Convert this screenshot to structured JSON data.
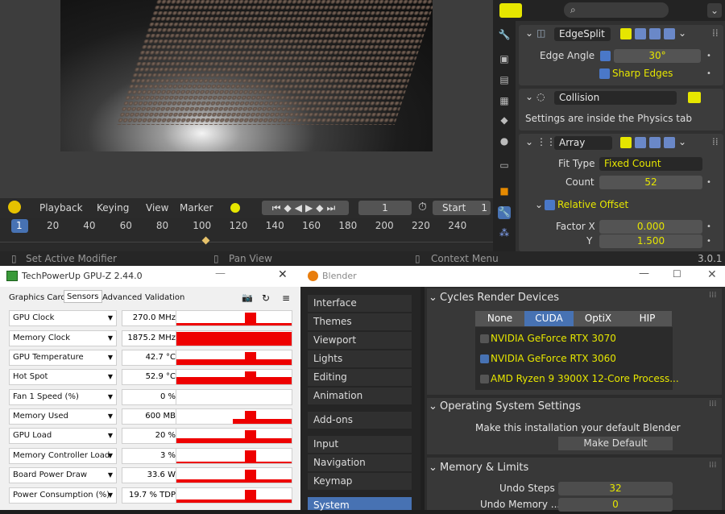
{
  "viewport": {
    "description_hidden": ""
  },
  "timeline": {
    "playback": "Playback",
    "keying": "Keying",
    "view": "View",
    "marker": "Marker",
    "current_frame": "1",
    "start_label": "Start",
    "start_value": "1",
    "ruler": [
      "1",
      "20",
      "40",
      "60",
      "80",
      "100",
      "120",
      "140",
      "160",
      "180",
      "200",
      "220",
      "240"
    ]
  },
  "status": {
    "left": "Set Active Modifier",
    "middle": "Pan View",
    "right": "Context Menu",
    "version": "3.0.1"
  },
  "properties": {
    "edgesplit": {
      "name": "EdgeSplit",
      "edge_angle_label": "Edge Angle",
      "edge_angle_value": "30°",
      "sharp_edges_label": "Sharp Edges"
    },
    "collision": {
      "name": "Collision",
      "info": "Settings are inside the Physics tab"
    },
    "array": {
      "name": "Array",
      "fit_type_label": "Fit Type",
      "fit_type_value": "Fixed Count",
      "count_label": "Count",
      "count_value": "52",
      "relative_offset_label": "Relative Offset",
      "factor_x_label": "Factor X",
      "factor_x_value": "0.000",
      "y_label": "Y",
      "y_value": "1.500"
    }
  },
  "gpuz": {
    "title": "TechPowerUp GPU-Z 2.44.0",
    "tabs": [
      "Graphics Card",
      "Sensors",
      "Advanced",
      "Validation"
    ],
    "sensors": [
      {
        "name": "GPU Clock",
        "value": "270.0 MHz",
        "level": 0.1
      },
      {
        "name": "Memory Clock",
        "value": "1875.2 MHz",
        "level": 0.6
      },
      {
        "name": "GPU Temperature",
        "value": "42.7 °C",
        "level": 0.25
      },
      {
        "name": "Hot Spot",
        "value": "52.9 °C",
        "level": 0.3
      },
      {
        "name": "Fan 1 Speed (%)",
        "value": "0 %",
        "level": 0
      },
      {
        "name": "Memory Used",
        "value": "600 MB",
        "level": 0.2
      },
      {
        "name": "GPU Load",
        "value": "20 %",
        "level": 0.2
      },
      {
        "name": "Memory Controller Load",
        "value": "3 %",
        "level": 0.05
      },
      {
        "name": "Board Power Draw",
        "value": "33.6 W",
        "level": 0.15
      },
      {
        "name": "Power Consumption (%)",
        "value": "19.7 % TDP",
        "level": 0.15
      }
    ]
  },
  "prefs": {
    "title": "Blender",
    "nav": [
      "Interface",
      "Themes",
      "Viewport",
      "Lights",
      "Editing",
      "Animation",
      "Add-ons",
      "Input",
      "Navigation",
      "Keymap",
      "System"
    ],
    "cycles_title": "Cycles Render Devices",
    "device_tabs": [
      "None",
      "CUDA",
      "OptiX",
      "HIP"
    ],
    "devices": [
      {
        "name": "NVIDIA GeForce RTX 3070",
        "checked": false
      },
      {
        "name": "NVIDIA GeForce RTX 3060",
        "checked": true
      },
      {
        "name": "AMD Ryzen 9 3900X 12-Core Process...",
        "checked": false
      }
    ],
    "os_title": "Operating System Settings",
    "os_text": "Make this installation your default Blender",
    "make_default": "Make Default",
    "mem_title": "Memory & Limits",
    "undo_steps_label": "Undo Steps",
    "undo_steps_value": "32",
    "undo_memory_label": "Undo Memory ...",
    "undo_memory_value": "0"
  },
  "colors": {
    "accent": "#4772b3",
    "yellow": "#e6e600",
    "red": "#ee0000"
  }
}
